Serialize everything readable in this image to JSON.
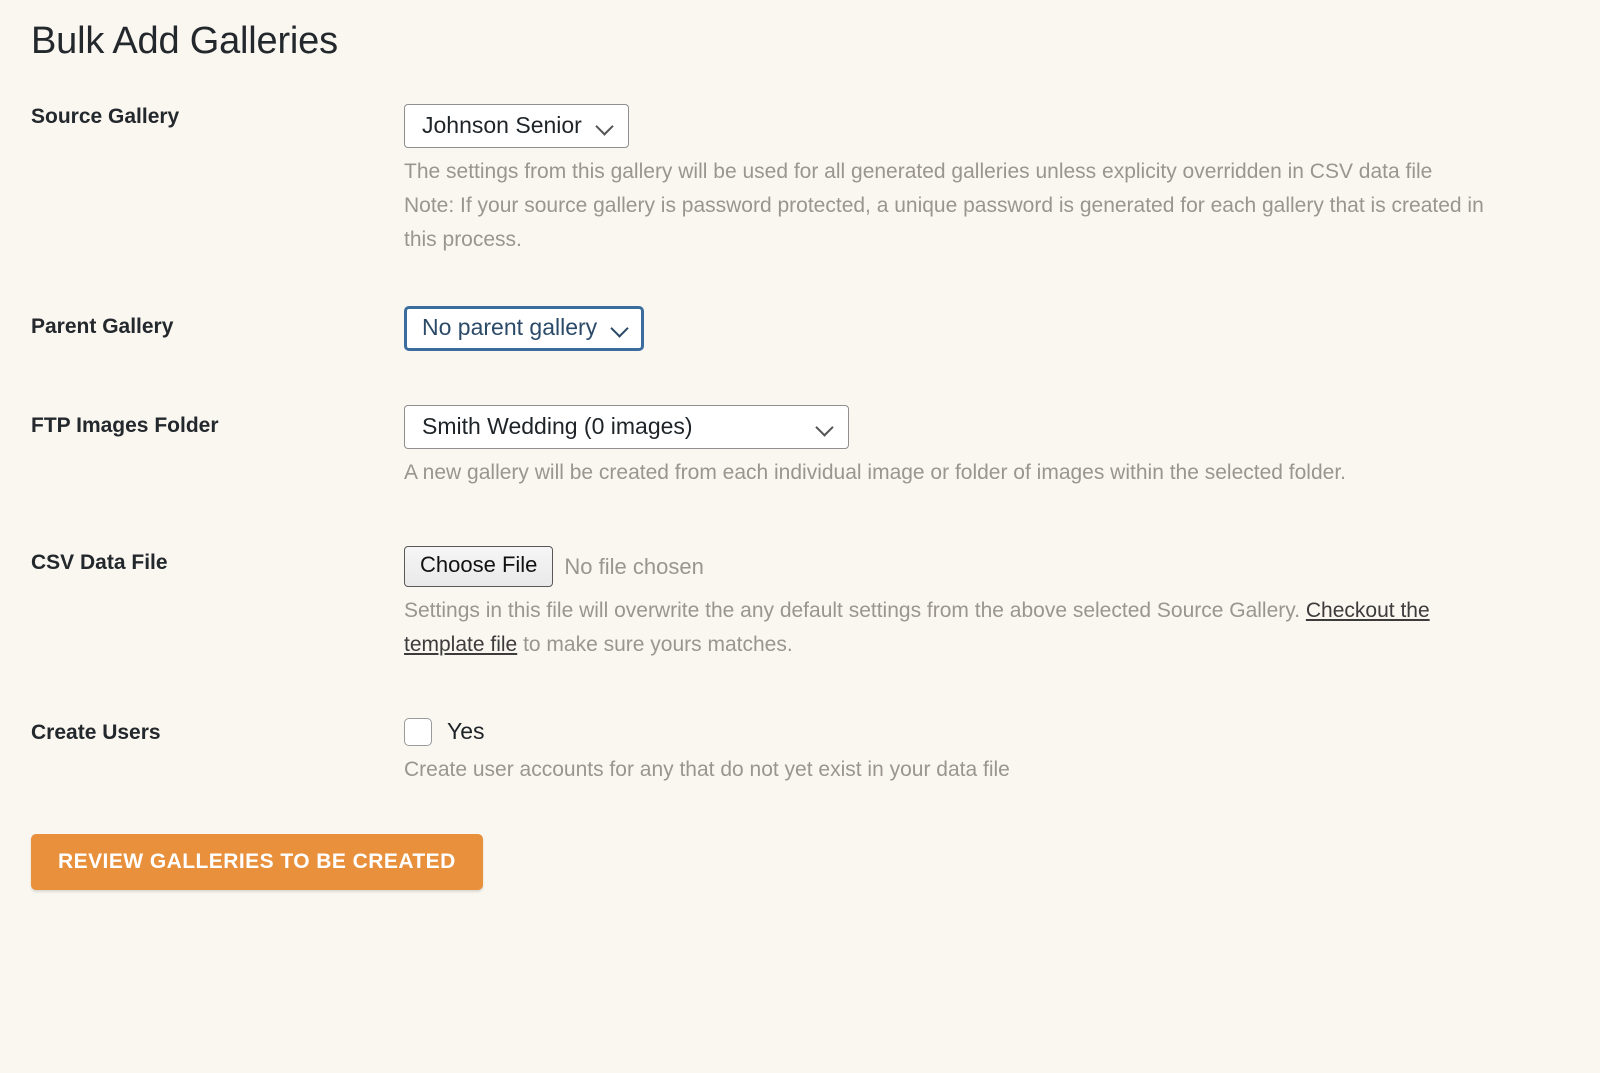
{
  "page": {
    "title": "Bulk Add Galleries",
    "background_color": "#faf6f0"
  },
  "fields": {
    "source_gallery": {
      "label": "Source Gallery",
      "selected": "Johnson Senior",
      "focused": false,
      "help_line_1": "The settings from this gallery will be used for all generated galleries unless explicity overridden in CSV data file",
      "help_line_2": "Note: If your source gallery is password protected, a unique password is generated for each gallery that is created in this process."
    },
    "parent_gallery": {
      "label": "Parent Gallery",
      "selected": "No parent gallery",
      "focused": true,
      "focus_border_color": "#3a6c9e",
      "focus_text_color": "#2b4a68"
    },
    "ftp_images_folder": {
      "label": "FTP Images Folder",
      "selected": "Smith Wedding (0 images)",
      "focused": false,
      "help": "A new gallery will be created from each individual image or folder of images within the selected folder."
    },
    "csv_data_file": {
      "label": "CSV Data File",
      "choose_file_label": "Choose File",
      "file_status": "No file chosen",
      "help_prefix": "Settings in this file will overwrite the any default settings from the above selected Source Gallery. ",
      "help_link": "Checkout the template file",
      "help_suffix": " to make sure yours matches."
    },
    "create_users": {
      "label": "Create Users",
      "checkbox_label": "Yes",
      "checked": false,
      "help": "Create user accounts for any that do not yet exist in your data file"
    }
  },
  "actions": {
    "submit_label": "Review Galleries to be Created",
    "submit_color": "#e8903c"
  }
}
